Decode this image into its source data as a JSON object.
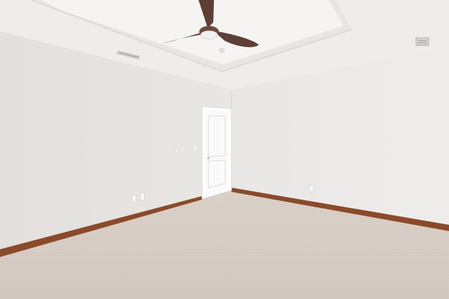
{
  "scene": {
    "description_tags": [
      "empty-room",
      "tray-ceiling",
      "ceiling-fan",
      "white-door",
      "carpet-floor",
      "wood-baseboard"
    ],
    "colors": {
      "left_wall": "#e4e1df",
      "right_wall": "#ebe9e7",
      "ceiling": "#f0efee",
      "tray_inner": "#f4f3f2",
      "carpet": "#d6ccc4",
      "baseboard": "#8a4a2b",
      "door": "#fafafa",
      "fan_blade": "#5d3f36",
      "fan_light": "#f2f0ee"
    },
    "icons": {
      "fan": "ceiling-fan-icon",
      "vent": "air-vent-icon",
      "outlet": "power-outlet-icon",
      "switch": "light-switch-icon"
    }
  }
}
